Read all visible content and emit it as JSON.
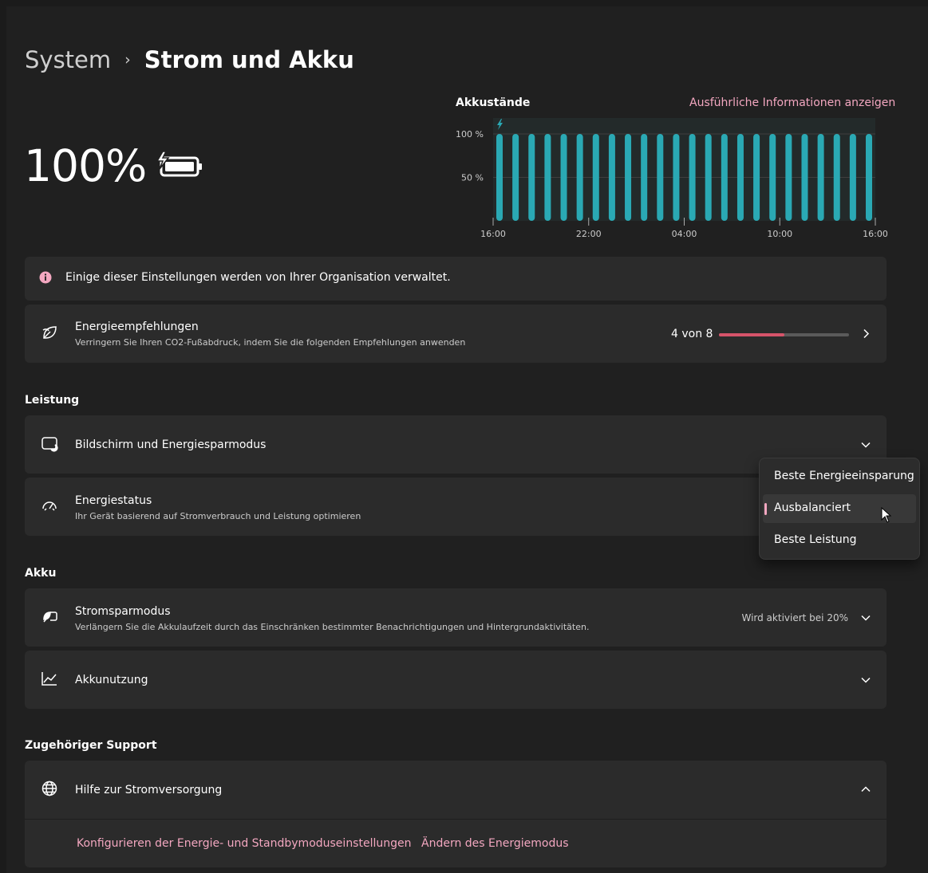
{
  "breadcrumb": {
    "parent": "System",
    "separator": "›",
    "current": "Strom und Akku"
  },
  "battery": {
    "level_text": "100%",
    "level": 100,
    "charging": true
  },
  "chart": {
    "title": "Akkustände",
    "link": "Ausführliche Informationen anzeigen",
    "y_ticks": [
      "100 %",
      "50 %"
    ],
    "x_ticks": [
      "16:00",
      "22:00",
      "04:00",
      "10:00",
      "16:00"
    ],
    "bar_color": "#2aa9b4"
  },
  "chart_data": {
    "type": "bar",
    "title": "Akkustände",
    "xlabel": "",
    "ylabel": "",
    "ylim": [
      0,
      100
    ],
    "x_tick_labels": [
      "16:00",
      "22:00",
      "04:00",
      "10:00",
      "16:00"
    ],
    "y_tick_labels": [
      "100 %",
      "50 %"
    ],
    "values": [
      100,
      100,
      100,
      100,
      100,
      100,
      100,
      100,
      100,
      100,
      100,
      100,
      100,
      100,
      100,
      100,
      100,
      100,
      100,
      100,
      100,
      100,
      100,
      100
    ],
    "grid": true
  },
  "notice": {
    "text": "Einige dieser Einstellungen werden von Ihrer Organisation verwaltet."
  },
  "energy_recs": {
    "title": "Energieempfehlungen",
    "subtitle": "Verringern Sie Ihren CO2-Fußabdruck, indem Sie die folgenden Empfehlungen anwenden",
    "progress_text": "4 von 8",
    "progress_fraction": 0.5
  },
  "sections": {
    "performance": "Leistung",
    "battery": "Akku",
    "support": "Zugehöriger Support"
  },
  "screen_sleep": {
    "title": "Bildschirm und Energiesparmodus"
  },
  "power_mode": {
    "title": "Energiestatus",
    "subtitle": "Ihr Gerät basierend auf Stromverbrauch und Leistung optimieren",
    "options": [
      "Beste Energieeinsparung",
      "Ausbalanciert",
      "Beste Leistung"
    ],
    "selected": "Ausbalanciert"
  },
  "battery_saver": {
    "title": "Stromsparmodus",
    "subtitle": "Verlängern Sie die Akkulaufzeit durch das Einschränken bestimmter Benachrichtigungen und Hintergrundaktivitäten.",
    "status": "Wird aktiviert bei 20%"
  },
  "battery_usage": {
    "title": "Akkunutzung"
  },
  "help": {
    "title": "Hilfe zur Stromversorgung",
    "links": [
      "Konfigurieren der Energie- und Standbymoduseinstellungen",
      "Ändern des Energiemodus"
    ]
  },
  "colors": {
    "accent": "#f3a7c0",
    "progress": "#d6546a",
    "bars": "#2aa9b4",
    "notice_icon": "#f3a7c0"
  }
}
